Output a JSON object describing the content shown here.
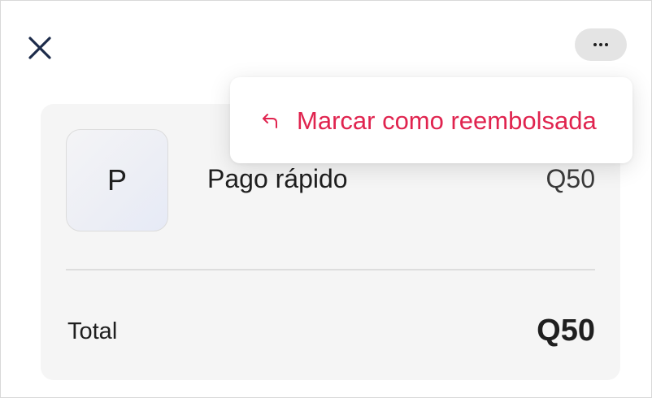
{
  "header": {
    "close_icon": "close-icon",
    "more_icon": "more-horizontal-icon"
  },
  "menu": {
    "items": [
      {
        "label": "Marcar como reembolsada",
        "icon": "undo-arrow-icon",
        "color": "#e0244f"
      }
    ]
  },
  "order": {
    "items": [
      {
        "avatar_letter": "P",
        "name": "Pago rápido",
        "price": "Q50"
      }
    ],
    "total_label": "Total",
    "total_value": "Q50"
  }
}
